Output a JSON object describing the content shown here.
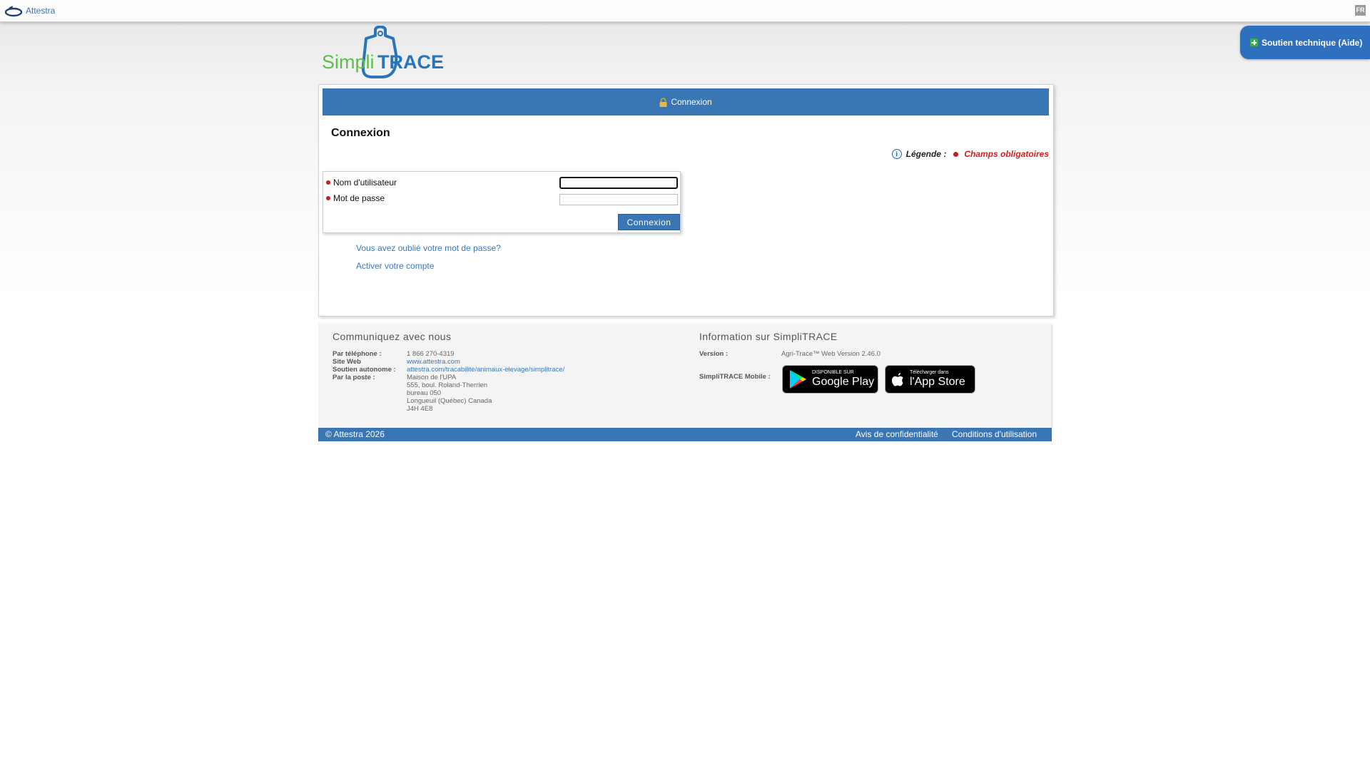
{
  "topbar": {
    "brand": "Attestra",
    "lang": "FR"
  },
  "support": {
    "label": "Soutien technique (Aide)"
  },
  "logo": {
    "text_simpli": "Simpli",
    "text_trace": "TRACE"
  },
  "panel": {
    "header": "Connexion",
    "title": "Connexion",
    "legend_label": "Légende :",
    "legend_required": "Champs obligatoires"
  },
  "form": {
    "username_label": "Nom d'utilisateur",
    "password_label": "Mot de passe",
    "username_value": "",
    "password_value": "",
    "submit_label": "Connexion"
  },
  "links": {
    "forgot": "Vous avez oublié votre mot de passe?",
    "activate": "Activer votre compte"
  },
  "contact": {
    "title": "Communiquez avec nous",
    "phone_label": "Par téléphone :",
    "phone": "1 866 270-4319",
    "web_label": "Site Web",
    "web": "www.attestra.com",
    "support_label": "Soutien autonome :",
    "support_url": "attestra.com/tracabilite/animaux-elevage/simplitrace/",
    "mail_label": "Par la poste :",
    "address": [
      "Maison de l'UPA",
      "555, boul. Roland-Therrien",
      "bureau 050",
      "Longueuil (Québec) Canada",
      "J4H 4E8"
    ]
  },
  "info": {
    "title": "Information sur SimpliTRACE",
    "version_label": "Version :",
    "version": "Agri-Trace™ Web Version 2.46.0",
    "mobile_label": "SimpliTRACE Mobile :",
    "google_small": "DISPONIBLE SUR",
    "google_big": "Google Play",
    "apple_small": "Télécharger dans",
    "apple_big": "l'App Store"
  },
  "footer": {
    "copyright": "© Attestra 2026",
    "privacy": "Avis de confidentialité",
    "terms": "Conditions d'utilisation"
  },
  "colors": {
    "primary": "#3a76b4",
    "support": "#2e6fbe",
    "required": "#c81e1e",
    "logo_green": "#5cbf4a"
  }
}
